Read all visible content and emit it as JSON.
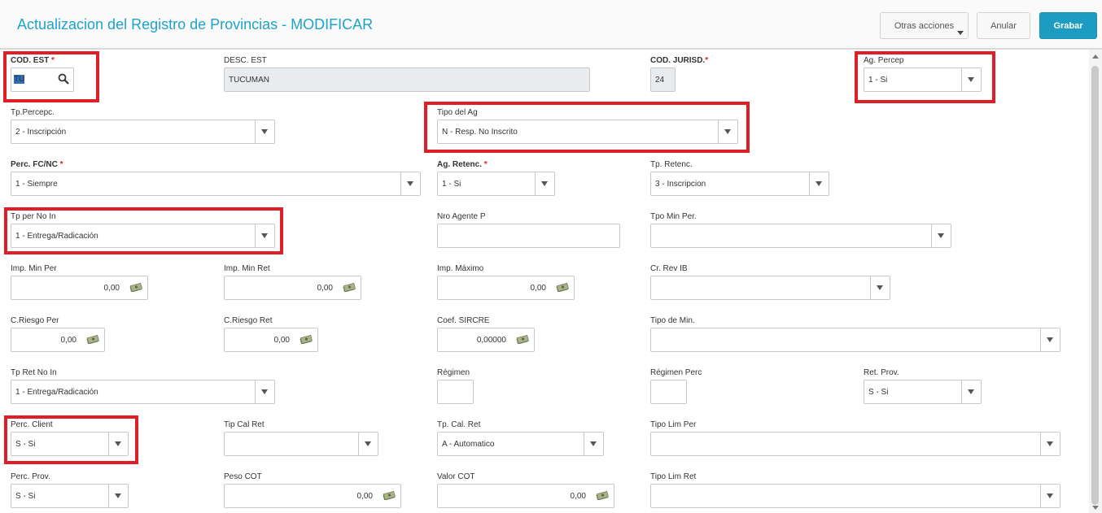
{
  "header": {
    "title": "Actualizacion del Registro de Provincias - MODIFICAR",
    "otras_label": "Otras acciones",
    "anular_label": "Anular",
    "grabar_label": "Grabar"
  },
  "fields": {
    "cod_est": {
      "label": "COD. EST",
      "required": "*",
      "value": "TU"
    },
    "desc_est": {
      "label": "DESC. EST",
      "value": "TUCUMAN"
    },
    "cod_jurisd": {
      "label": "COD. JURISD.",
      "required": "*",
      "value": "24"
    },
    "ag_percep": {
      "label": "Ag. Percep",
      "value": "1 - Si"
    },
    "tp_percepc": {
      "label": "Tp.Percepc.",
      "value": "2 - Inscripción"
    },
    "tipo_del_ag": {
      "label": "Tipo del Ag",
      "value": "N - Resp. No Inscrito"
    },
    "perc_fc_nc": {
      "label": "Perc. FC/NC",
      "required": "*",
      "value": "1 - Siempre"
    },
    "ag_retenc": {
      "label": "Ag. Retenc.",
      "required": "*",
      "value": "1 - Si"
    },
    "tp_retenc": {
      "label": "Tp. Retenc.",
      "value": "3 - Inscripcion"
    },
    "tp_per_no_in": {
      "label": "Tp per No In",
      "value": "1 - Entrega/Radicación"
    },
    "nro_agente_p": {
      "label": "Nro Agente P",
      "value": ""
    },
    "tpo_min_per": {
      "label": "Tpo Min Per.",
      "value": ""
    },
    "imp_min_per": {
      "label": "Imp. Min Per",
      "value": "0,00"
    },
    "imp_min_ret": {
      "label": "Imp. Min Ret",
      "value": "0,00"
    },
    "imp_maximo": {
      "label": "Imp. Máximo",
      "value": "0,00"
    },
    "cr_rev_ib": {
      "label": "Cr. Rev IB",
      "value": ""
    },
    "c_riesgo_per": {
      "label": "C.Riesgo Per",
      "value": "0,00"
    },
    "c_riesgo_ret": {
      "label": "C.Riesgo Ret",
      "value": "0,00"
    },
    "coef_sircre": {
      "label": "Coef. SIRCRE",
      "value": "0,00000"
    },
    "tipo_de_min": {
      "label": "Tipo de Min.",
      "value": ""
    },
    "tp_ret_no_in": {
      "label": "Tp Ret No In",
      "value": "1 - Entrega/Radicación"
    },
    "regimen": {
      "label": "Régimen",
      "value": ""
    },
    "regimen_perc": {
      "label": "Régimen Perc",
      "value": ""
    },
    "ret_prov": {
      "label": "Ret. Prov.",
      "value": "S - Si"
    },
    "perc_client": {
      "label": "Perc. Client",
      "value": "S - Si"
    },
    "tip_cal_ret": {
      "label": "Tip Cal Ret",
      "value": ""
    },
    "tp_cal_ret": {
      "label": "Tp. Cal. Ret",
      "value": "A - Automatico"
    },
    "tipo_lim_per": {
      "label": "Tipo Lim Per",
      "value": ""
    },
    "perc_prov": {
      "label": "Perc. Prov.",
      "value": "S - Si"
    },
    "peso_cot": {
      "label": "Peso COT",
      "value": "0,00"
    },
    "valor_cot": {
      "label": "Valor COT",
      "value": "0,00"
    },
    "tipo_lim_ret": {
      "label": "Tipo Lim Ret",
      "value": ""
    }
  },
  "icons": {
    "search": "magnifier-icon",
    "money": "money-bills-icon",
    "dropdown": "chevron-down-icon"
  },
  "colors": {
    "title": "#1ea3c9",
    "primary_button": "#1c9cc3",
    "highlight": "#e01e25",
    "required": "#e02020"
  }
}
